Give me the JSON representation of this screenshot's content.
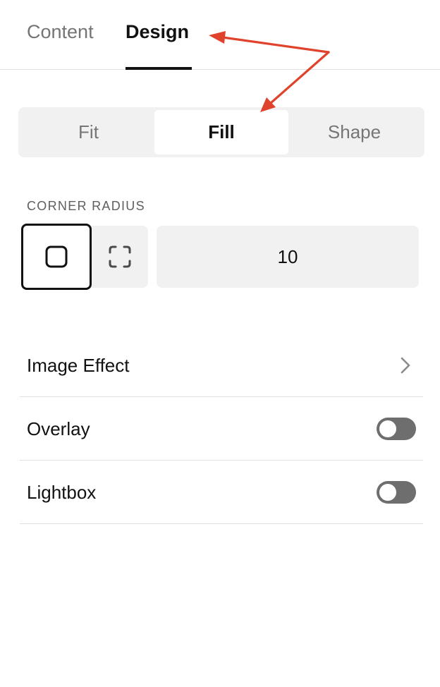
{
  "tabs": [
    {
      "label": "Content",
      "selected": false
    },
    {
      "label": "Design",
      "selected": true
    }
  ],
  "fill_mode": {
    "options": [
      {
        "label": "Fit",
        "selected": false
      },
      {
        "label": "Fill",
        "selected": true
      },
      {
        "label": "Shape",
        "selected": false
      }
    ]
  },
  "corner_radius": {
    "label": "CORNER RADIUS",
    "mode": "uniform",
    "value": "10"
  },
  "options": {
    "image_effect": {
      "label": "Image Effect",
      "icon": "chevron-right-icon"
    },
    "overlay": {
      "label": "Overlay",
      "enabled": false
    },
    "lightbox": {
      "label": "Lightbox",
      "enabled": false
    }
  },
  "colors": {
    "annotation": "#e0432c",
    "toggle_off": "#6e6e6e",
    "segment_bg": "#f1f1f1"
  }
}
